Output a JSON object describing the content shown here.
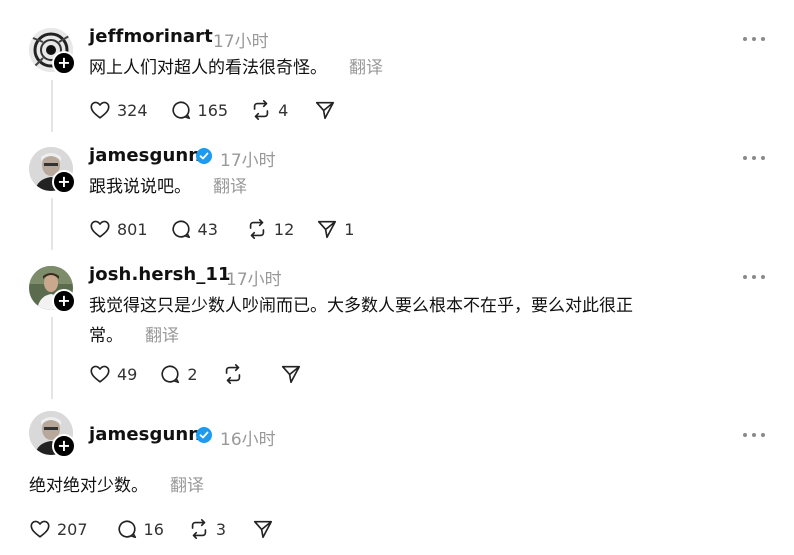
{
  "translate_label": "翻译",
  "icons": {
    "like": "heart-icon",
    "reply": "comment-icon",
    "repost": "repost-icon",
    "share": "send-icon",
    "more": "more-icon",
    "follow": "plus-icon",
    "verified": "verified-badge-icon"
  },
  "colors": {
    "verified": "#1d9bf0",
    "muted": "#999999",
    "thread_line": "#e5e5e5"
  },
  "posts": [
    {
      "username": "jeffmorinart",
      "time": "17小时",
      "verified": false,
      "text": "网上人们对超人的看法很奇怪。",
      "likes": "324",
      "replies": "165",
      "reposts": "4",
      "shares": ""
    },
    {
      "username": "jamesgunn",
      "time": "17小时",
      "verified": true,
      "text": "跟我说说吧。",
      "likes": "801",
      "replies": "43",
      "reposts": "12",
      "shares": "1"
    },
    {
      "username": "josh.hersh_11",
      "time": "17小时",
      "verified": false,
      "text_line1": "我觉得这只是少数人吵闹而已。大多数人要么根本不在乎，要么对此很正",
      "text_line2": "常。",
      "likes": "49",
      "replies": "2",
      "reposts": "",
      "shares": ""
    },
    {
      "username": "jamesgunn",
      "time": "16小时",
      "verified": true,
      "text": "绝对绝对少数。",
      "likes": "207",
      "replies": "16",
      "reposts": "3",
      "shares": ""
    }
  ]
}
